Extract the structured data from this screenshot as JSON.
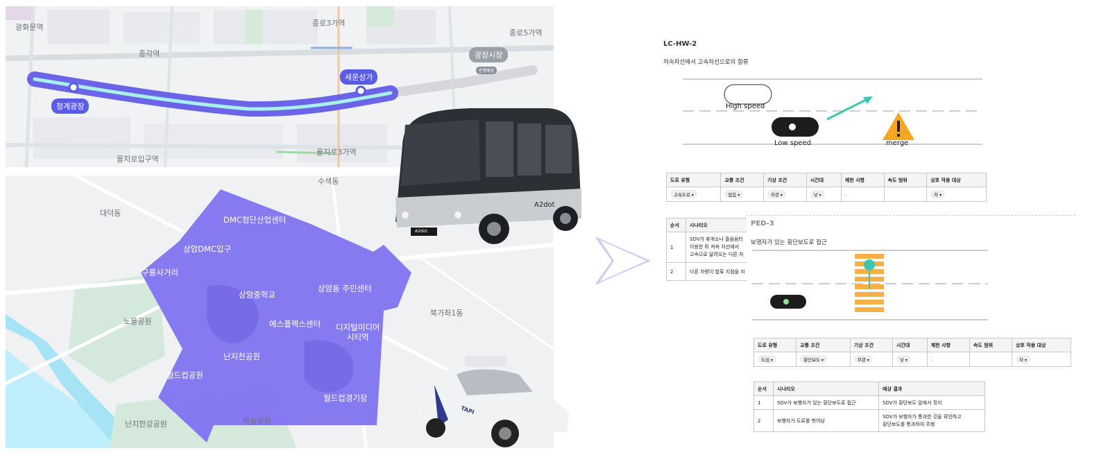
{
  "map_top": {
    "station_labels": [
      "광화문역",
      "종로3가역",
      "종로5가역",
      "종각역",
      "을지로입구역",
      "을지로3가역"
    ],
    "route_pins": [
      "청계광장",
      "세운상가"
    ],
    "gray_pin": "광장시장",
    "gray_pin_sub": "운행예정"
  },
  "map_bottom": {
    "area_labels": [
      "수색동",
      "대덕동",
      "북가좌1동",
      "노을공원",
      "난지한강공원",
      "하늘공원"
    ],
    "zone_labels": [
      "DMC첨단산업센터",
      "상암DMC입구",
      "구룡사거리",
      "상암중학교",
      "상암동 주민센터",
      "에스플렉스센터",
      "디지털미디어\n시티역",
      "난지천공원",
      "월드컵공원",
      "월드컵경기장"
    ],
    "zone_color": "#7f73f0"
  },
  "vehicles": {
    "bus_brand": "A2dot",
    "bus_plate": "A2dot",
    "taxi_brand": "TAPI"
  },
  "colors": {
    "route": "#6b63e8",
    "route_inner": "#a8f0ec",
    "arrow": "#5a57b8",
    "teal": "#3cc8b0",
    "warning": "#f5a623",
    "crosswalk": "#f7b046"
  },
  "doc1": {
    "id": "LC-HW-2",
    "subtitle": "저속차선에서 고속차선으로의 합류",
    "diagram": {
      "high_speed": "High speed",
      "low_speed": "Low speed",
      "merge": "merge"
    },
    "attr_headers": [
      "도로 유형",
      "교통 조건",
      "기상 조건",
      "시간대",
      "제한 사항",
      "속도 범위",
      "상호 작용 대상"
    ],
    "attr_values": [
      "고속도로",
      "없음",
      "무관",
      "낮",
      ".",
      "",
      "차"
    ],
    "scen_headers": [
      "순서",
      "시나리오"
    ],
    "scen_rows": [
      [
        "1",
        "SDV가 휴게소나 졸음쉼터\n이용한 뒤 저속 차선에서\n고속으로 달려오는 다른 차"
      ],
      [
        "2",
        "다른 차량이 합류 지점을 지"
      ]
    ]
  },
  "doc2": {
    "id": "PED-3",
    "subtitle": "보행자가 있는 횡단보도로 접근",
    "attr_headers": [
      "도로 유형",
      "교통 조건",
      "기상 조건",
      "시간대",
      "제한 사항",
      "속도 범위",
      "상호 작용 대상"
    ],
    "attr_values": [
      "도심",
      "횡단보도",
      "무관",
      "낮",
      ".",
      "",
      "차"
    ],
    "scen_headers": [
      "순서",
      "시나리오",
      "예상 결과"
    ],
    "scen_rows": [
      [
        "1",
        "SDV가 보행자가 있는 횡단보도로 접근",
        "SDV가 횡단보도 앞에서 정지"
      ],
      [
        "2",
        "보행자가 도로를 벗어남",
        "SDV가 보행자가 통과한 것을 확인하고\n횡단보도를 통과하여 주행"
      ]
    ]
  }
}
